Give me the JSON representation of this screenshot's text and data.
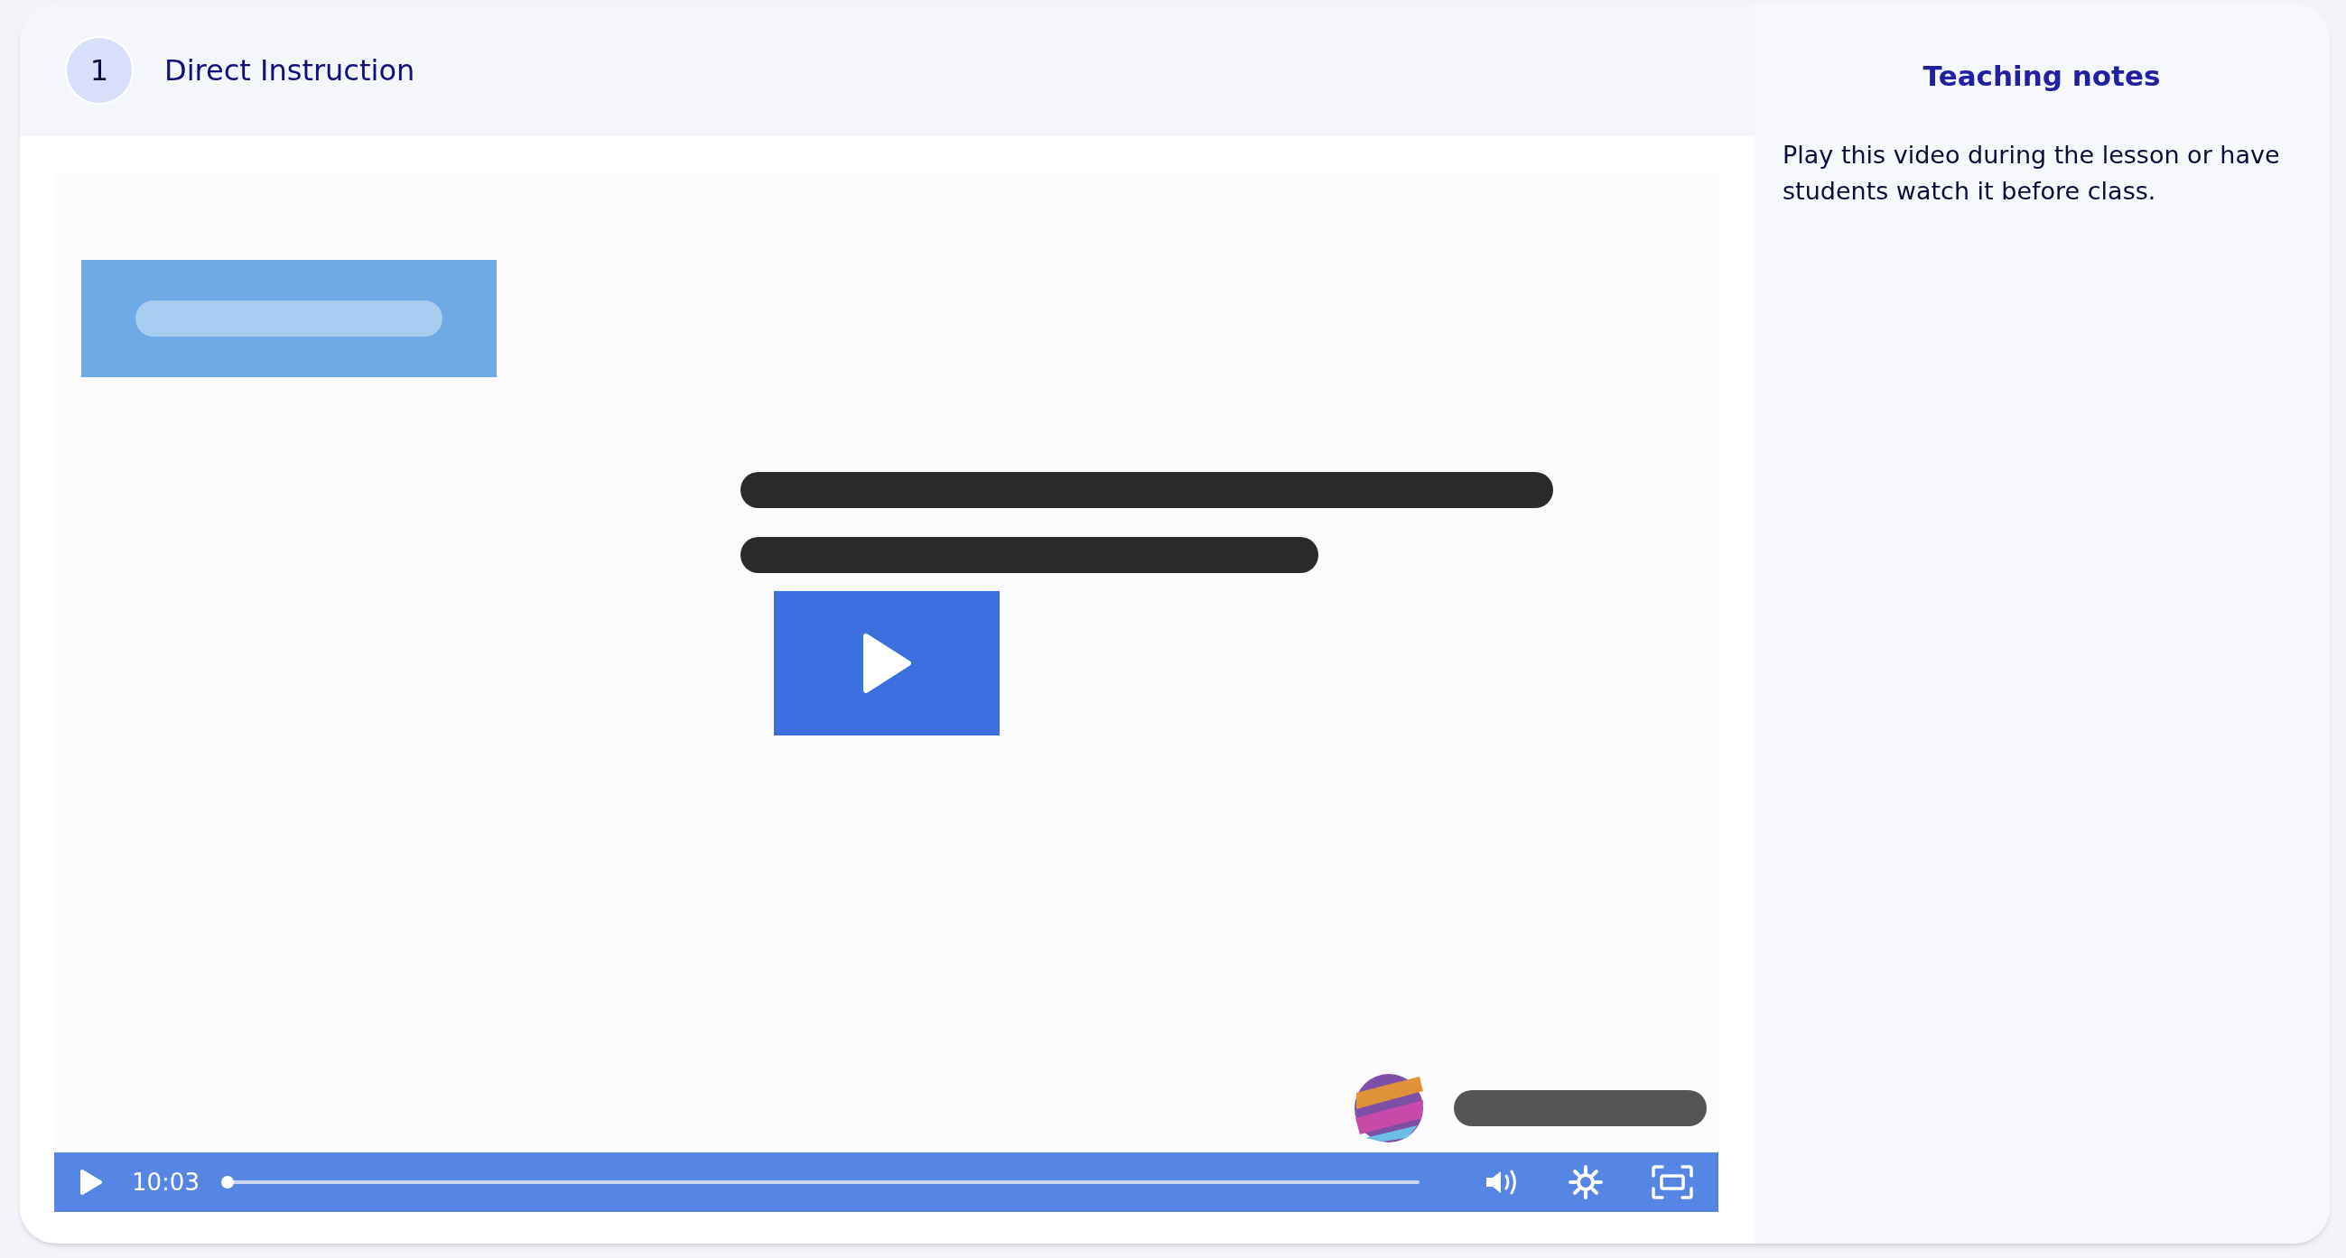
{
  "section": {
    "number": "1",
    "title": "Direct Instruction"
  },
  "video": {
    "kind": "picture",
    "time": "10:03",
    "progress": {
      "level": 0.0
    }
  },
  "teaching_notes": {
    "title": "Teaching notes",
    "text": "Play this video during the lesson or have students watch it before class."
  }
}
